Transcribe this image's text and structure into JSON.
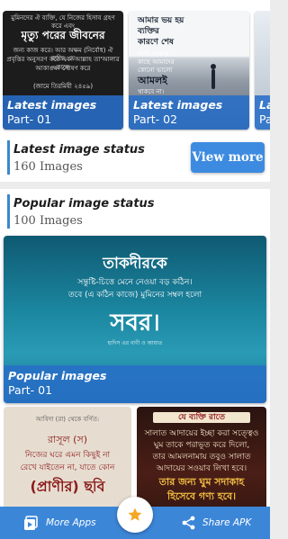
{
  "latest_carousel": {
    "cards": [
      {
        "title": "Latest images",
        "part": "Part- 01",
        "art_text": [
          "মুমিনদের ঐ ব্যক্তি, যে নিজের হিসাব গ্রহণ করে এবং",
          "মৃত্যু পরের জীবনের",
          "জন্য কাজ করে। আর অক্ষম (নির্বোধ) ঐ ব্যক্তি, যে",
          "প্রবৃত্তির অনুসরণ করে এবং আল্লাহ তা'আলার কাছে",
          "আকাঙ্ক্ষা পোষণ করে",
          "(জামে তিরমিযী ২৪৫৯)"
        ]
      },
      {
        "title": "Latest images",
        "part": "Part- 02",
        "art_text": [
          "আমার ভয় হয়",
          "ব্যক্তির",
          "কারণে শেষ",
          "পর্যন্ত আল্লাহ",
          "কাছে আমাদের",
          "কোনো ভালো",
          "আমলই",
          "থাকবে না।"
        ]
      },
      {
        "title": "Latest images",
        "part": "Part-"
      }
    ]
  },
  "latest_section": {
    "title": "Latest image status",
    "count": "160 Images",
    "view_more": "View more"
  },
  "popular_section": {
    "title": "Popular image status",
    "count": "100 Images",
    "featured": {
      "title": "Popular images",
      "part": "Part- 01",
      "art_heading": "তাকদীরকে",
      "art_body": [
        "সন্তুষ্টি-চিত্তে মেনে নেওয়া বড় কঠিন।",
        "তবে (এ কঠিন কাজে) মুমিনের সম্বল হলো"
      ],
      "art_word": "সবর।",
      "art_footer": "হাদিস এর বাণী ও আয়াত"
    },
    "left_card_text": [
      "আবিদা (রা) থেকে বর্ণিত:",
      "রাসূল (স)",
      "নিজের ঘরে এমন কিছুই না",
      "রেখে যাইতেন না, যাতে কোন",
      "(প্রাণীর) ছবি"
    ],
    "right_card_text": [
      "যে ব্যক্তি রাতে",
      "সালাত আদায়ের ইচ্ছা করা সত্ত্বেও",
      "ঘুম তাকে পরাভূত করে দিলো,",
      "তার আমলনামায় তবুও সালাত",
      "আদায়ের সওয়াব লিখা হবে।",
      "তার জন্য ঘুম সদাকাহ",
      "হিসেবে গণ্য হবে।"
    ]
  },
  "bottom_bar": {
    "more_apps": "More Apps",
    "share": "Share APK",
    "more_apps_icon": "apps-stack-icon",
    "fab_icon": "star-icon",
    "share_icon": "share-icon"
  },
  "colors": {
    "accent": "#3d87c9",
    "button": "#3d8be0",
    "bar": "#3c86d8",
    "star": "#f5a623"
  }
}
